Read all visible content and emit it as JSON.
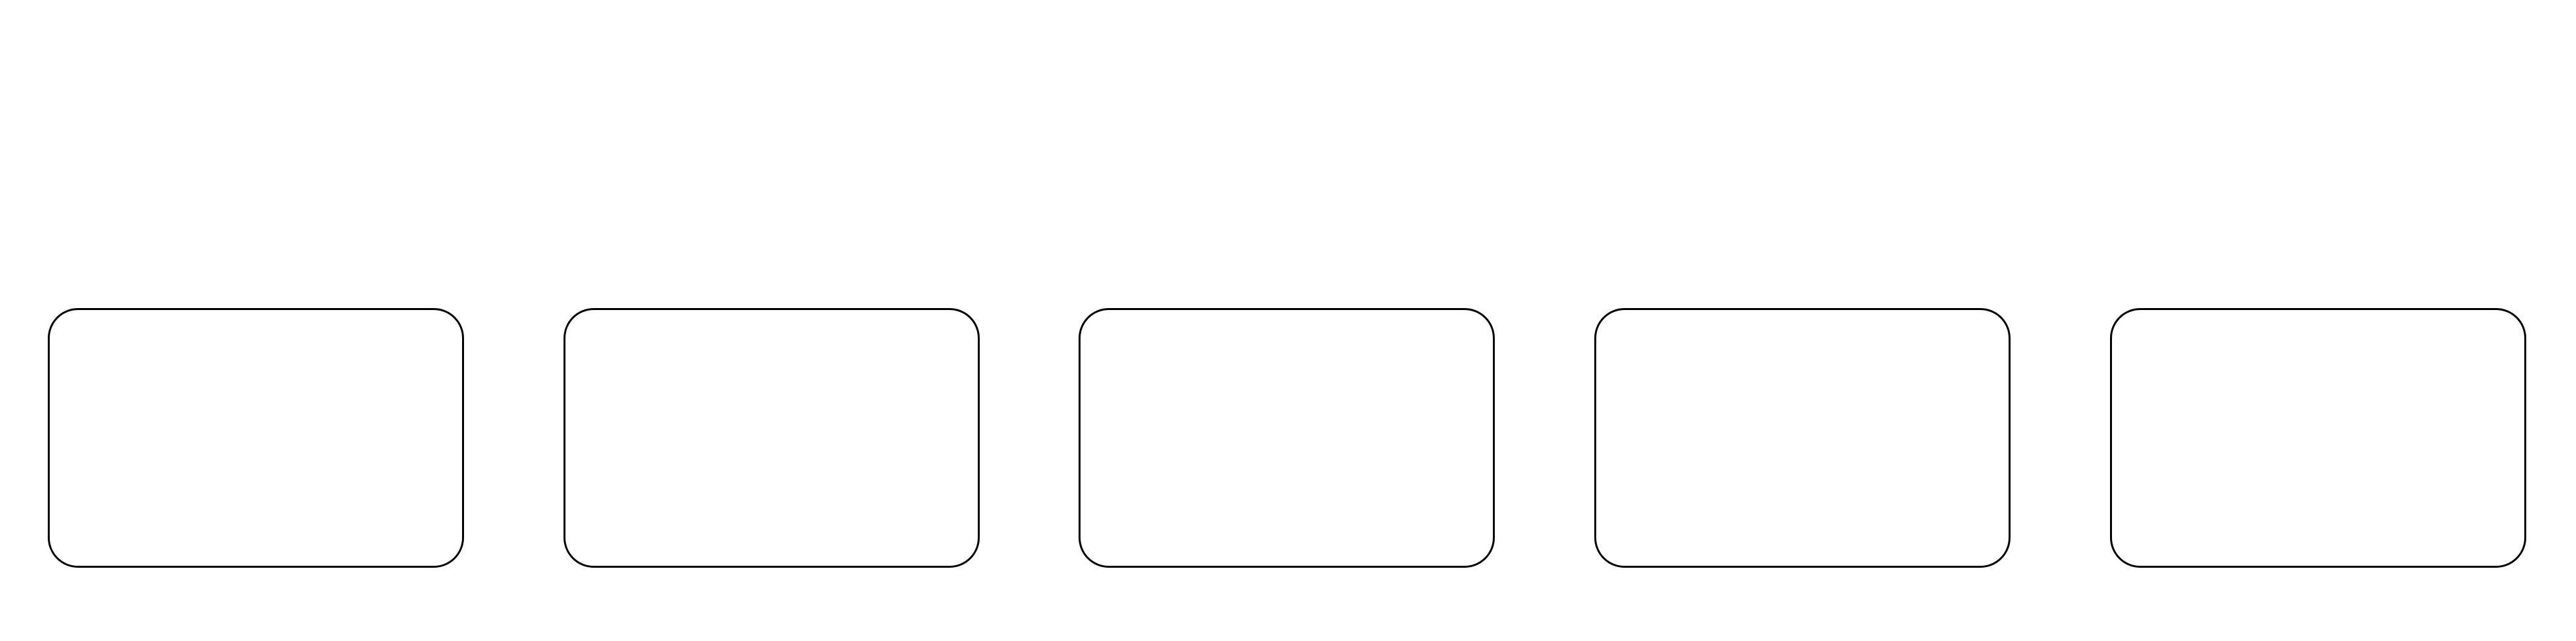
{
  "diagram": {
    "boxes": [
      {
        "label": ""
      },
      {
        "label": ""
      },
      {
        "label": ""
      },
      {
        "label": ""
      },
      {
        "label": ""
      }
    ]
  }
}
